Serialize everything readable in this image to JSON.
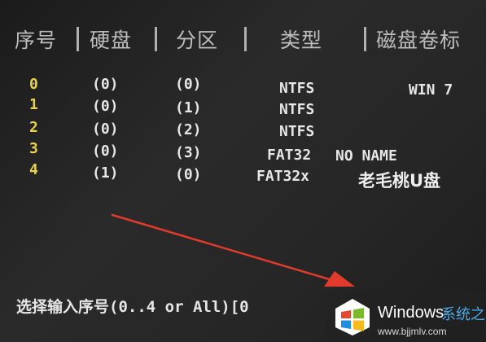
{
  "headers": {
    "index": "序号",
    "disk": "硬盘",
    "partition": "分区",
    "type": "类型",
    "label": "磁盘卷标"
  },
  "rows": [
    {
      "index": "0",
      "disk": "(0)",
      "partition": "(0)",
      "type": "NTFS",
      "label": "WIN 7"
    },
    {
      "index": "1",
      "disk": "(0)",
      "partition": "(1)",
      "type": "NTFS",
      "label": ""
    },
    {
      "index": "2",
      "disk": "(0)",
      "partition": "(2)",
      "type": "NTFS",
      "label": ""
    },
    {
      "index": "3",
      "disk": "(0)",
      "partition": "(3)",
      "type": "FAT32",
      "label": "NO NAME"
    },
    {
      "index": "4",
      "disk": "(1)",
      "partition": "(0)",
      "type": "FAT32x",
      "label": "老毛桃U盘"
    }
  ],
  "prompt": "选择输入序号(0..4 or All)[0",
  "watermark": {
    "brand": "Windows",
    "site": "系统之家",
    "url": "www.bjjmlv.com"
  },
  "colors": {
    "background": "#232323",
    "text": "#e6e6e6",
    "index_digits": "#e8d24c",
    "arrow": "#e03b2c",
    "watermark_site": "#4aa9ea"
  },
  "icons": {
    "arrow": "red-arrow-icon",
    "logo": "windows-logo-icon"
  }
}
